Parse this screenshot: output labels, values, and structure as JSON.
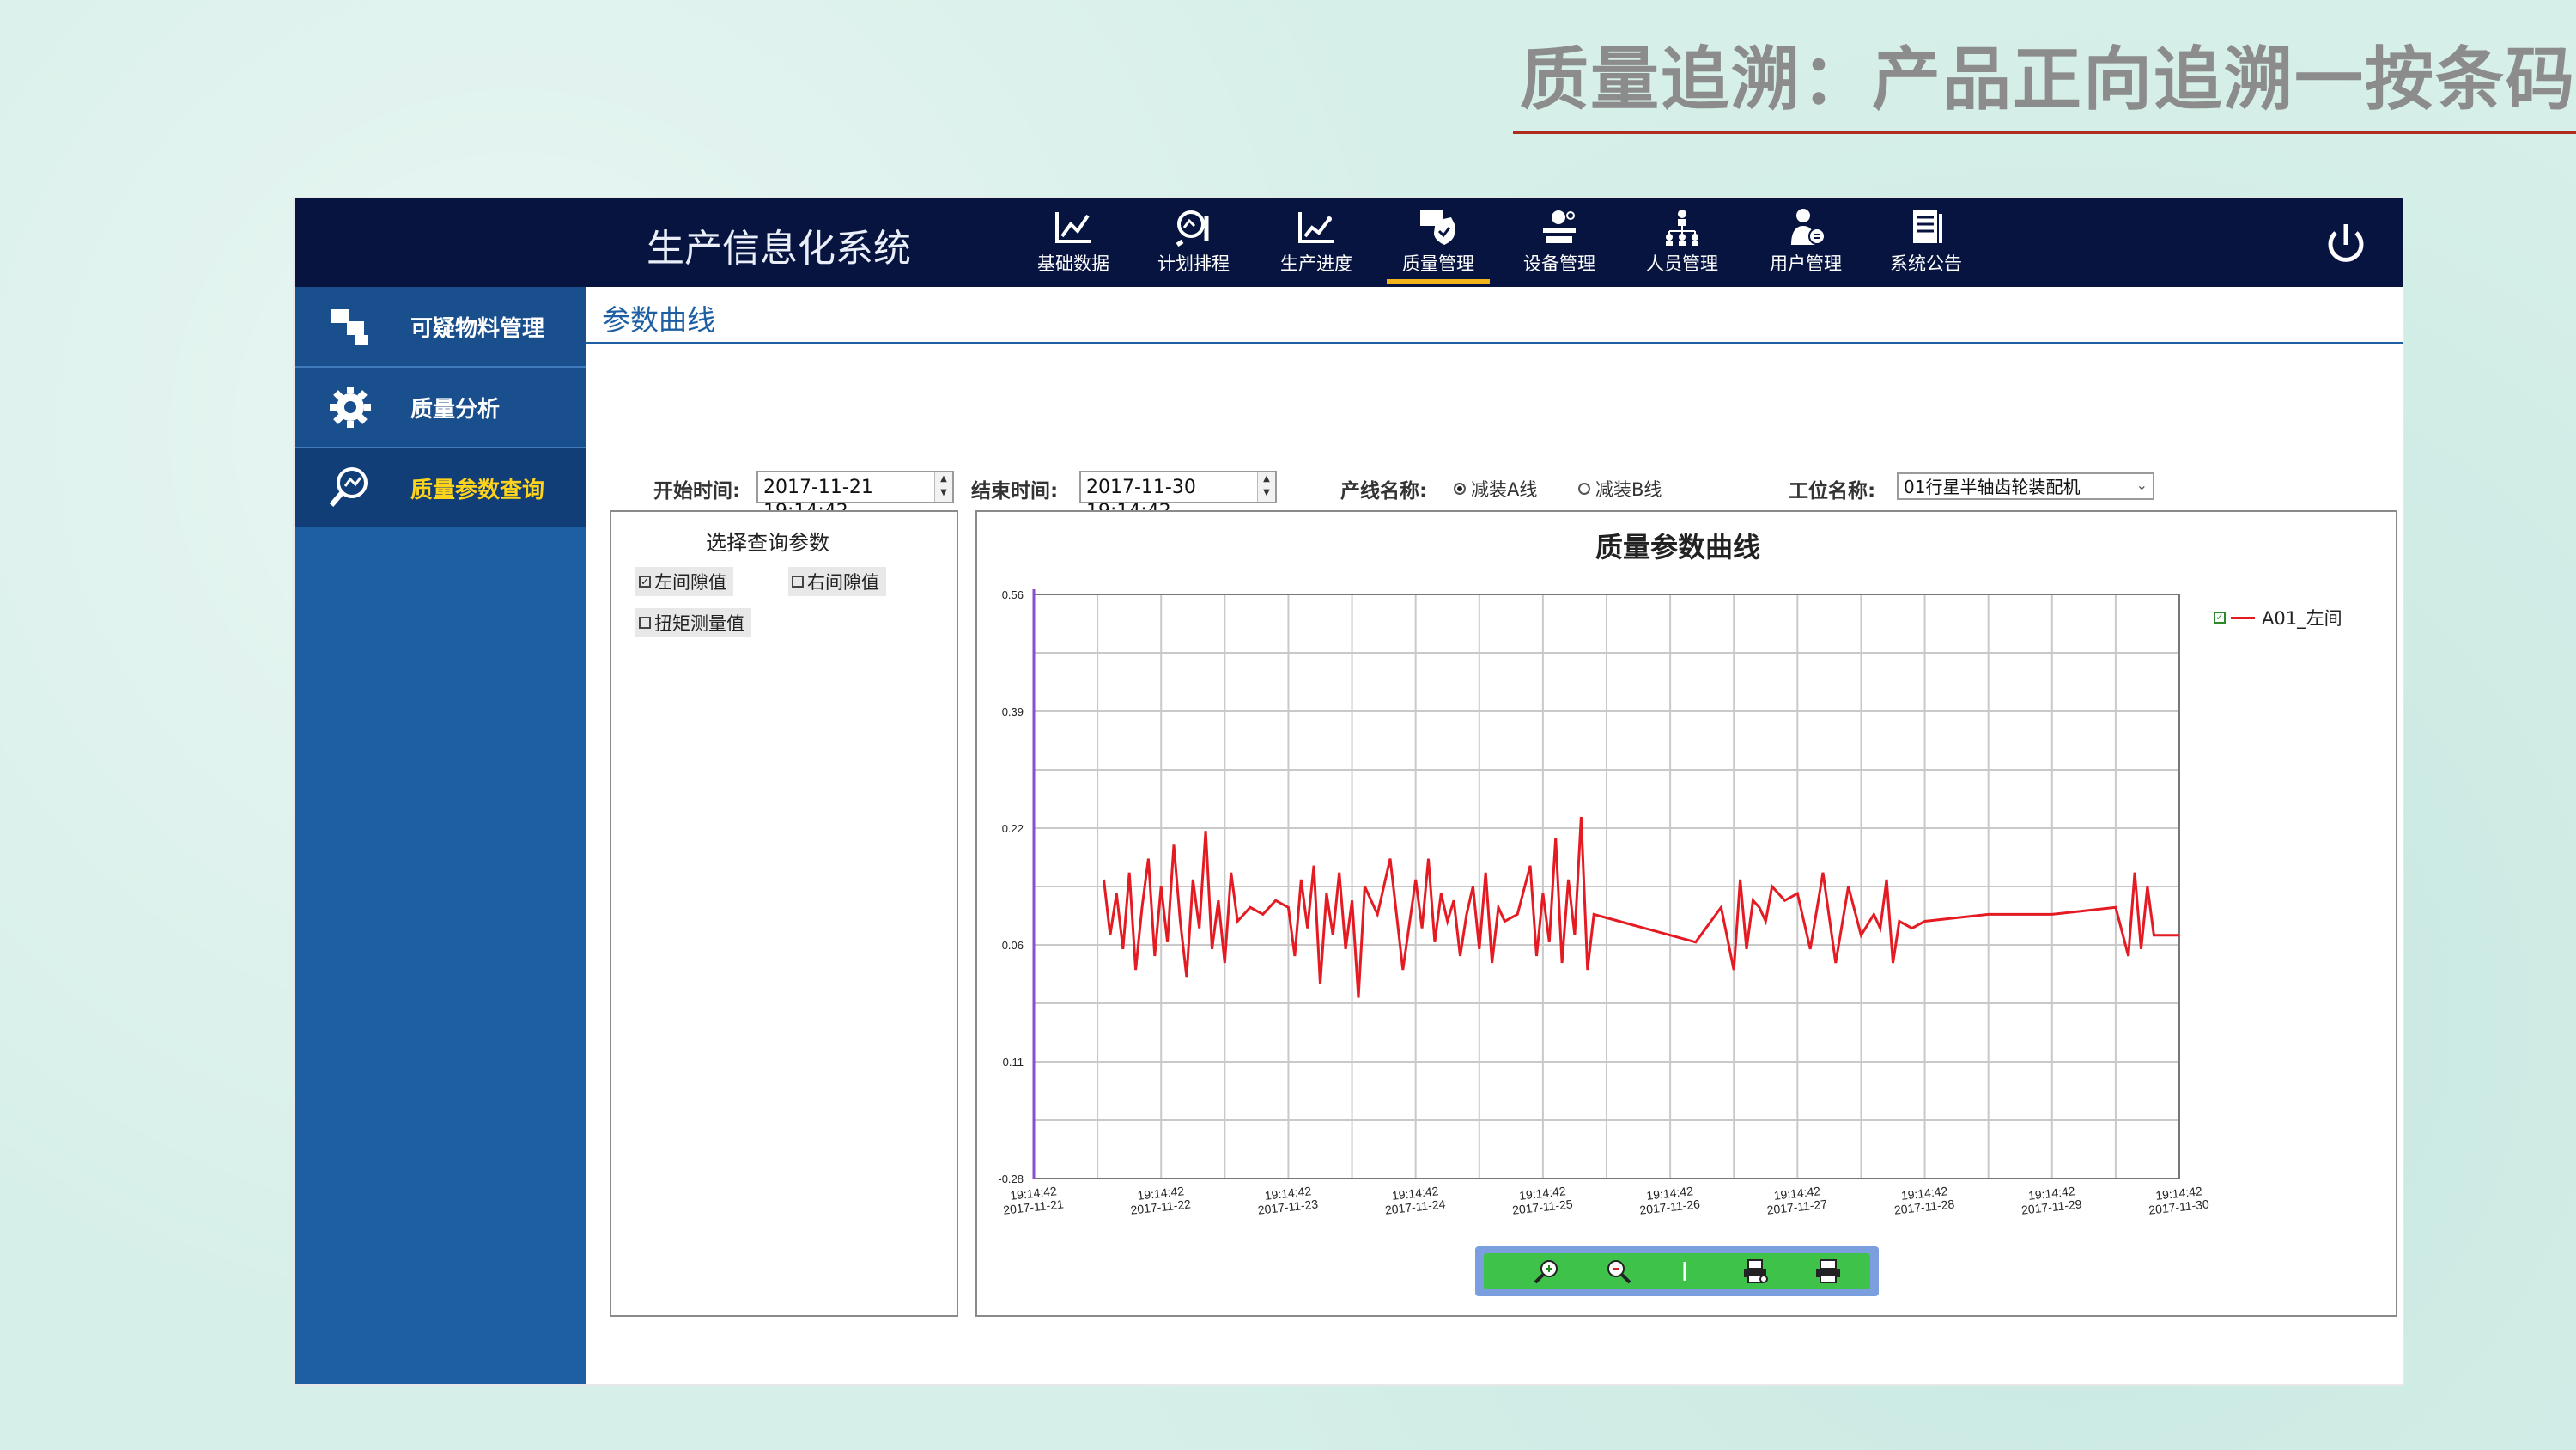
{
  "slide": {
    "title": "质量追溯：产品正向追溯一按条码"
  },
  "app": {
    "title": "生产信息化系统",
    "nav": [
      {
        "label": "基础数据",
        "icon": "line-chart-icon"
      },
      {
        "label": "计划排程",
        "icon": "search-chart-icon"
      },
      {
        "label": "生产进度",
        "icon": "progress-chart-icon"
      },
      {
        "label": "质量管理",
        "icon": "quality-shield-icon",
        "active": true
      },
      {
        "label": "设备管理",
        "icon": "equipment-icon"
      },
      {
        "label": "人员管理",
        "icon": "people-icon"
      },
      {
        "label": "用户管理",
        "icon": "user-icon"
      },
      {
        "label": "系统公告",
        "icon": "notice-icon"
      }
    ],
    "power_icon": "power-icon"
  },
  "sidebar": {
    "items": [
      {
        "label": "可疑物料管理",
        "icon": "boxes-icon"
      },
      {
        "label": "质量分析",
        "icon": "gear-icon"
      },
      {
        "label": "质量参数查询",
        "icon": "magnifier-chart-icon",
        "active": true
      }
    ]
  },
  "page": {
    "tab": "参数曲线",
    "filters": {
      "start_label": "开始时间:",
      "start_value": "2017-11-21 19:14:42",
      "end_label": "结束时间:",
      "end_value": "2017-11-30 19:14:42",
      "line_label": "产线名称:",
      "line_a": "减装A线",
      "line_b": "减装B线",
      "line_selected": "减装A线",
      "station_label": "工位名称:",
      "station_value": "01行星半轴齿轮装配机"
    },
    "params": {
      "title": "选择查询参数",
      "items": [
        {
          "label": "左间隙值",
          "checked": true
        },
        {
          "label": "右间隙值",
          "checked": false
        },
        {
          "label": "扭矩测量值",
          "checked": false
        }
      ]
    },
    "chart_title": "质量参数曲线",
    "legend": "A01_左间",
    "colors": {
      "series": "#e41b23",
      "nav_bg": "#07143f",
      "sidebar": "#1e5fa3",
      "accent": "#ffd21c"
    }
  },
  "chart_data": {
    "type": "line",
    "title": "质量参数曲线",
    "ylim": [
      -0.28,
      0.56
    ],
    "yticks": [
      "0.56",
      "0.39",
      "0.22",
      "0.06",
      "-0.11",
      "-0.28"
    ],
    "xticks": [
      [
        "19:14:42",
        "2017-11-21"
      ],
      [
        "19:14:42",
        "2017-11-22"
      ],
      [
        "19:14:42",
        "2017-11-23"
      ],
      [
        "19:14:42",
        "2017-11-24"
      ],
      [
        "19:14:42",
        "2017-11-25"
      ],
      [
        "19:14:42",
        "2017-11-26"
      ],
      [
        "19:14:42",
        "2017-11-27"
      ],
      [
        "19:14:42",
        "2017-11-28"
      ],
      [
        "19:14:42",
        "2017-11-29"
      ],
      [
        "19:14:42",
        "2017-11-30"
      ]
    ],
    "grid": true,
    "series": [
      {
        "name": "A01_左间",
        "x": [
          0.55,
          0.6,
          0.65,
          0.7,
          0.75,
          0.8,
          0.85,
          0.9,
          0.95,
          1.0,
          1.05,
          1.1,
          1.15,
          1.2,
          1.25,
          1.3,
          1.35,
          1.4,
          1.45,
          1.5,
          1.55,
          1.6,
          1.7,
          1.8,
          1.9,
          2.0,
          2.05,
          2.1,
          2.15,
          2.2,
          2.25,
          2.3,
          2.35,
          2.4,
          2.45,
          2.5,
          2.55,
          2.6,
          2.7,
          2.8,
          2.9,
          3.0,
          3.05,
          3.1,
          3.15,
          3.2,
          3.25,
          3.3,
          3.35,
          3.4,
          3.45,
          3.5,
          3.55,
          3.6,
          3.65,
          3.7,
          3.8,
          3.9,
          3.95,
          4.0,
          4.05,
          4.1,
          4.15,
          4.2,
          4.25,
          4.3,
          4.35,
          4.4,
          4.6,
          5.0,
          5.2,
          5.4,
          5.5,
          5.55,
          5.6,
          5.65,
          5.7,
          5.75,
          5.8,
          5.9,
          6.0,
          6.1,
          6.2,
          6.3,
          6.4,
          6.5,
          6.6,
          6.65,
          6.7,
          6.75,
          6.8,
          6.9,
          7.0,
          7.5,
          8.0,
          8.5,
          8.6,
          8.65,
          8.7,
          8.75,
          8.8,
          8.9,
          9.0
        ],
        "y": [
          0.15,
          0.07,
          0.13,
          0.05,
          0.16,
          0.02,
          0.11,
          0.18,
          0.04,
          0.14,
          0.06,
          0.2,
          0.09,
          0.01,
          0.15,
          0.08,
          0.22,
          0.05,
          0.12,
          0.03,
          0.16,
          0.09,
          0.11,
          0.1,
          0.12,
          0.11,
          0.04,
          0.15,
          0.08,
          0.17,
          0.0,
          0.13,
          0.07,
          0.16,
          0.05,
          0.12,
          -0.02,
          0.14,
          0.1,
          0.18,
          0.02,
          0.15,
          0.08,
          0.18,
          0.06,
          0.13,
          0.09,
          0.12,
          0.04,
          0.1,
          0.14,
          0.05,
          0.16,
          0.03,
          0.11,
          0.09,
          0.1,
          0.17,
          0.04,
          0.13,
          0.06,
          0.21,
          0.03,
          0.15,
          0.07,
          0.24,
          0.02,
          0.1,
          0.09,
          0.07,
          0.06,
          0.11,
          0.02,
          0.15,
          0.05,
          0.12,
          0.11,
          0.09,
          0.14,
          0.12,
          0.13,
          0.05,
          0.16,
          0.03,
          0.14,
          0.07,
          0.1,
          0.08,
          0.15,
          0.03,
          0.09,
          0.08,
          0.09,
          0.1,
          0.1,
          0.11,
          0.04,
          0.16,
          0.05,
          0.14,
          0.07,
          0.07,
          0.07
        ]
      }
    ]
  }
}
